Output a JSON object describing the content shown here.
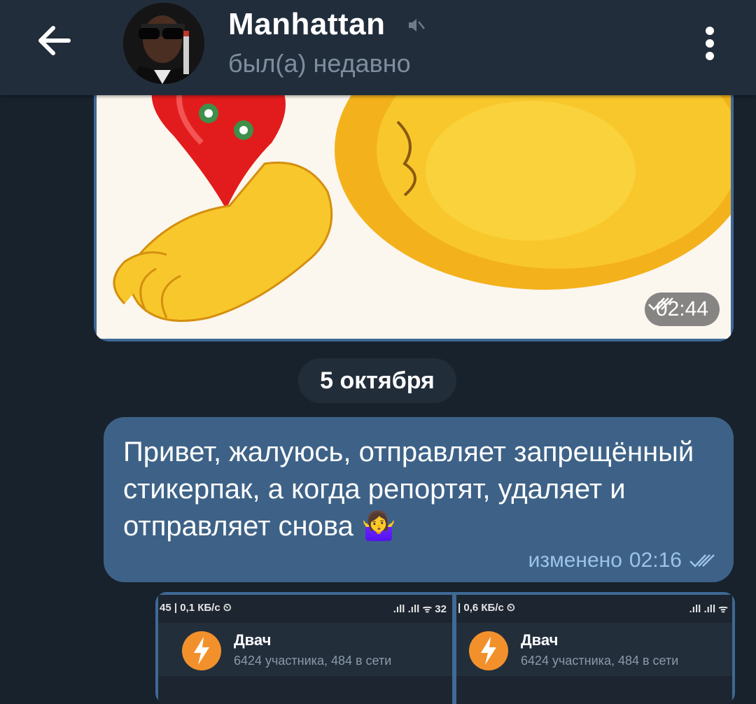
{
  "header": {
    "title": "Manhattan",
    "status": "был(а) недавно",
    "back_icon": "arrow-left-icon",
    "mute_icon": "muted-speaker-icon",
    "menu_icon": "more-vertical-icon"
  },
  "photo_message": {
    "time": "02:44",
    "status_icon": "double-check-icon"
  },
  "date_separator": "5 октября",
  "text_message": {
    "text": "Привет, жалуюсь, отправляет запрещённый стикерпак, а когда репортят, удаляет и отправляет снова 🤷‍♀️",
    "edited_label": "изменено",
    "time": "02:16",
    "status_icon": "double-check-icon"
  },
  "screenshots": [
    {
      "status_left": "45 | 0,1 КБ/с ⏲",
      "status_right": ".ıll .ıll ᯤ 32",
      "chat_name": "Двач",
      "members": "6424 участника, 484 в сети"
    },
    {
      "status_left": "| 0,6 КБ/с ⏲",
      "status_right": ".ıll .ıll ᯤ",
      "chat_name": "Двач",
      "members": "6424 участника, 484 в сети"
    }
  ],
  "colors": {
    "background": "#18222d",
    "header": "#212d3b",
    "outgoing_bubble": "#3e6287",
    "meta_text": "#9cc3e8"
  }
}
